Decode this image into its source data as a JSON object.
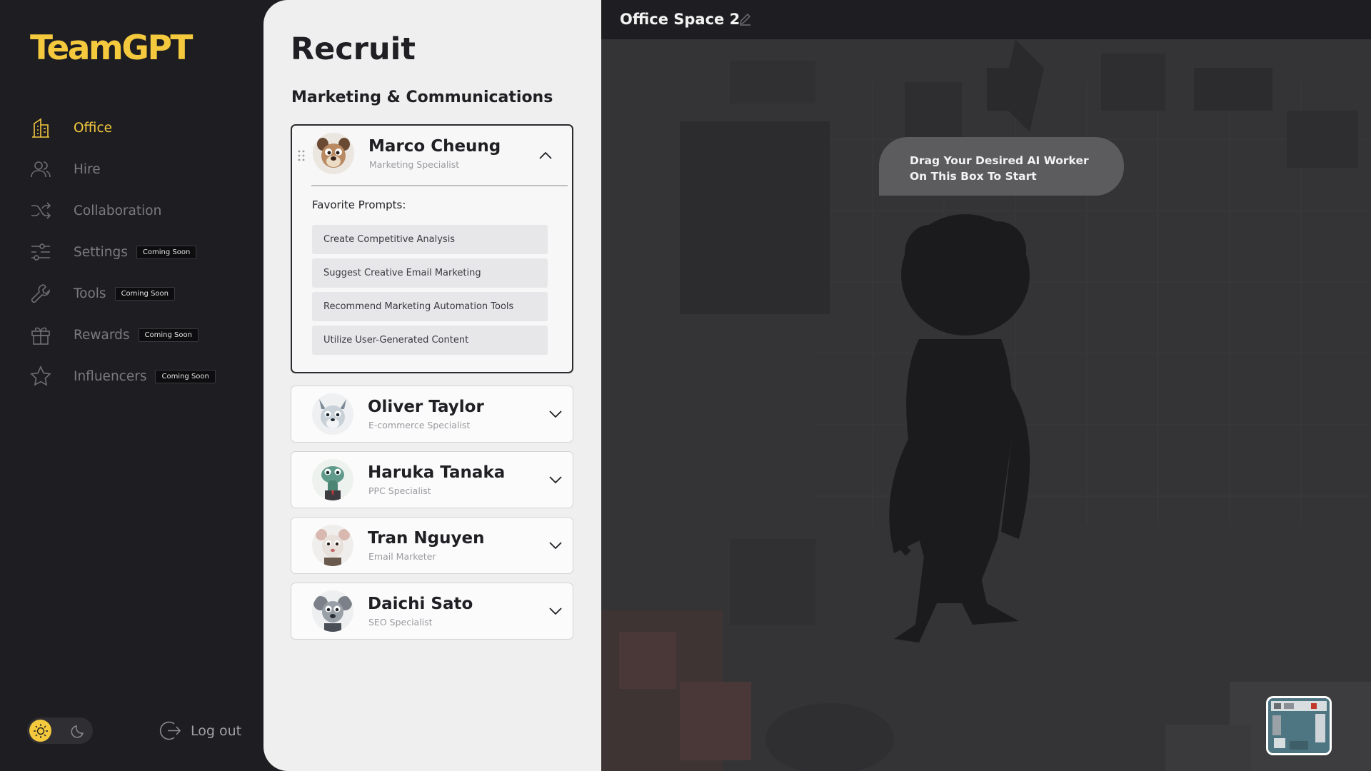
{
  "app": {
    "logo": "TeamGPT"
  },
  "sidebar": {
    "items": [
      {
        "label": "Office",
        "icon": "building-icon",
        "active": true,
        "badge": ""
      },
      {
        "label": "Hire",
        "icon": "users-icon",
        "active": false,
        "badge": ""
      },
      {
        "label": "Collaboration",
        "icon": "shuffle-icon",
        "active": false,
        "badge": ""
      },
      {
        "label": "Settings",
        "icon": "sliders-icon",
        "active": false,
        "badge": "Coming Soon"
      },
      {
        "label": "Tools",
        "icon": "wrench-icon",
        "active": false,
        "badge": "Coming Soon"
      },
      {
        "label": "Rewards",
        "icon": "gift-icon",
        "active": false,
        "badge": "Coming Soon"
      },
      {
        "label": "Influencers",
        "icon": "star-icon",
        "active": false,
        "badge": "Coming Soon"
      }
    ],
    "logout_label": "Log out",
    "theme": "light"
  },
  "recruit": {
    "title": "Recruit",
    "subtitle": "Marketing & Communications",
    "favorite_prompts_label": "Favorite Prompts:",
    "workers": [
      {
        "name": "Marco Cheung",
        "role": "Marketing Specialist",
        "expanded": true,
        "prompts": [
          "Create Competitive Analysis",
          "Suggest Creative Email Marketing",
          "Recommend Marketing Automation Tools",
          "Utilize User-Generated Content"
        ]
      },
      {
        "name": "Oliver Taylor",
        "role": "E-commerce Specialist",
        "expanded": false
      },
      {
        "name": "Haruka Tanaka",
        "role": "PPC Specialist",
        "expanded": false
      },
      {
        "name": "Tran Nguyen",
        "role": "Email Marketer",
        "expanded": false
      },
      {
        "name": "Daichi Sato",
        "role": "SEO Specialist",
        "expanded": false
      }
    ]
  },
  "office": {
    "title": "Office Space 2",
    "drop_hint_line1": "Drag Your Desired AI Worker",
    "drop_hint_line2": "On This Box To Start"
  },
  "colors": {
    "accent": "#f4c93d",
    "sidebar_bg": "#1e1e22",
    "panel_bg": "#efefef",
    "office_bg": "#333336"
  }
}
